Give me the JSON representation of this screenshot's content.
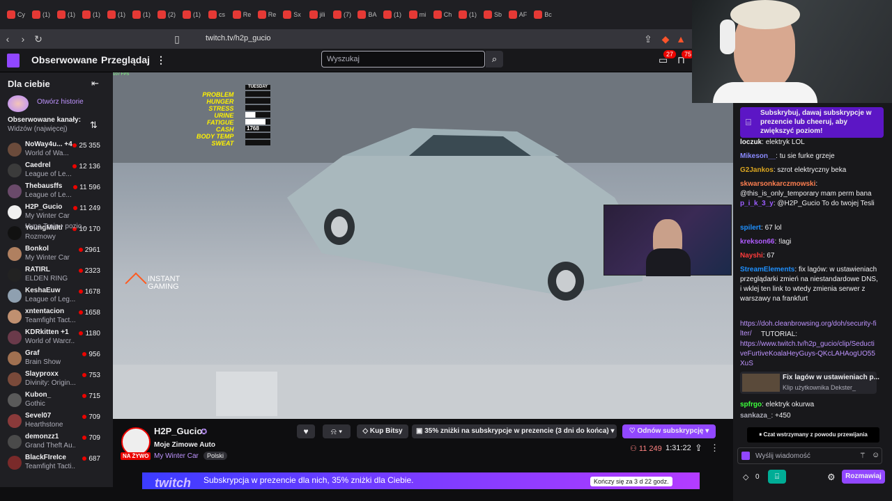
{
  "browser": {
    "tabs": [
      "Cy",
      "(1)",
      "(1)",
      "(1)",
      "(1)",
      "(1)",
      "(2)",
      "(1)",
      "cs",
      "Re",
      "Re",
      "Sx",
      "jili",
      "(7)",
      "BA",
      "(1)",
      "mi",
      "Ch",
      "(1)",
      "Sb",
      "AF",
      "Bc"
    ],
    "url": "twitch.tv/h2p_gucio"
  },
  "twitch": {
    "nav_following": "Obserwowane",
    "nav_browse": "Przeglądaj",
    "search_placeholder": "Wyszukaj",
    "notif_count": "27",
    "inbox_count": "75"
  },
  "sidebar": {
    "title": "Dla ciebie",
    "stories": "Otwórz historie",
    "followed_title": "Obserwowane kanały:",
    "followed_sort": "Widzów (najwięcej)",
    "channels": [
      {
        "name": "NoWay4u... +4",
        "game": "World of Wa...",
        "viewers": "25 355"
      },
      {
        "name": "Caedrel",
        "game": "League of Le...",
        "viewers": "12 136"
      },
      {
        "name": "Thebausffs",
        "game": "League of Le...",
        "viewers": "11 596"
      },
      {
        "name": "H2P_Gucio",
        "game": "My Winter Car",
        "viewers": "11 249"
      },
      {
        "name": "YoungMulti",
        "game": "Rozmowy",
        "viewers": "10 170"
      },
      {
        "name": "Bonkol",
        "game": "My Winter Car",
        "viewers": "2961"
      },
      {
        "name": "RATIRL",
        "game": "ELDEN RING",
        "viewers": "2323"
      },
      {
        "name": "KeshaEuw",
        "game": "League of Leg...",
        "viewers": "1678"
      },
      {
        "name": "xntentacion",
        "game": "Teamfight Tact...",
        "viewers": "1658"
      },
      {
        "name": "KDRkitten +1",
        "game": "World of Warcr...",
        "viewers": "1180"
      },
      {
        "name": "Graf",
        "game": "Brain Show",
        "viewers": "956"
      },
      {
        "name": "Slayproxx",
        "game": "Divinity: Origin...",
        "viewers": "753"
      },
      {
        "name": "Kubon_",
        "game": "Gothic",
        "viewers": "715"
      },
      {
        "name": "Sevel07",
        "game": "Hearthstone",
        "viewers": "709"
      },
      {
        "name": "demonzz1",
        "game": "Grand Theft Au...",
        "viewers": "709"
      },
      {
        "name": "BlackFIreIce",
        "game": "Teamfight Tacti...",
        "viewers": "687"
      }
    ],
    "hype_train": "Hype Train • pozio..."
  },
  "video": {
    "fps": "107 FPS",
    "hud_labels": [
      "PROBLEM",
      "HUNGER",
      "STRESS",
      "URINE",
      "FATIGUE",
      "CASH",
      "BODY TEMP",
      "SWEAT"
    ],
    "day": "TUESDAY",
    "cash": "1768",
    "sponsor": "INSTANT GAMING"
  },
  "stream": {
    "channel": "H2P_Gucio",
    "title": "Moje Zimowe Auto",
    "game": "My Winter Car",
    "tag": "Polski",
    "live": "NA ŻYWO",
    "bits": "Kup Bitsy",
    "promo": "35% zniżki na subskrypcje w prezencie (3 dni do końca)",
    "gift": "Odnów subskrypcję",
    "viewers": "11 249",
    "uptime": "1:31:22",
    "banner": "Subskrypcja w prezencie dla nich, 35% zniżki dla Ciebie.",
    "banner_timer": "Kończy się za 3 d 22 godz."
  },
  "chat": {
    "pinned": "Subskrybuj, dawaj subskrypcje w prezencie lub cheeruj, aby zwiększyć poziom!",
    "messages": [
      {
        "user": "loczuk",
        "color": "#efeff1",
        "text": "elektryk LOL"
      },
      {
        "user": "Mikeson__",
        "color": "#8a8aff",
        "text": "tu sie furke grzeje"
      },
      {
        "user": "G2Jankos",
        "color": "#daa520",
        "text": "szrot elektryczny beka"
      },
      {
        "user": "skwarsonkarczmowski",
        "color": "#ff7f50",
        "text": "@this_is_only_temporary mam perm bana"
      },
      {
        "user": "p_i_k_3_y",
        "color": "#9b5cff",
        "text": "@H2P_Gucio To do twojej Tesli"
      },
      {
        "user": "spilert",
        "color": "#1e90ff",
        "text": "67 lol"
      },
      {
        "user": "krekson66",
        "color": "#b05cff",
        "text": "!lagi"
      },
      {
        "user": "Nayshi",
        "color": "#ff3b3b",
        "text": "67"
      },
      {
        "user": "StreamElements",
        "color": "#1e90ff",
        "text": "fix lagów: w ustawieniach przeglądarki zmień na niestandardowe DNS, i wklej ten link to wtedy zmienia serwer z warszawy na frankfurt"
      },
      {
        "user": "spfrgo",
        "color": "#3cff3c",
        "text": "elektryk okurwa"
      },
      {
        "user": "sankaza_",
        "color": "#adadb8",
        "text": "+450"
      }
    ],
    "link1": "https://doh.cleanbrowsing.org/doh/security-filter/",
    "link_tut": "TUTORIAL:",
    "link2": "https://www.twitch.tv/h2p_gucio/clip/SeductiveFurtiveKoalaHeyGuys-QKcLAHAogUO55XuS",
    "clip_title": "Fix lagów w ustawieniach p...",
    "clip_by": "Klip użytkownika Dekster_",
    "paused": "Czat wstrzymany z powodu przewijania",
    "send_placeholder": "Wyślij wiadomość",
    "points": "0",
    "chat_btn": "Rozmawiaj"
  }
}
